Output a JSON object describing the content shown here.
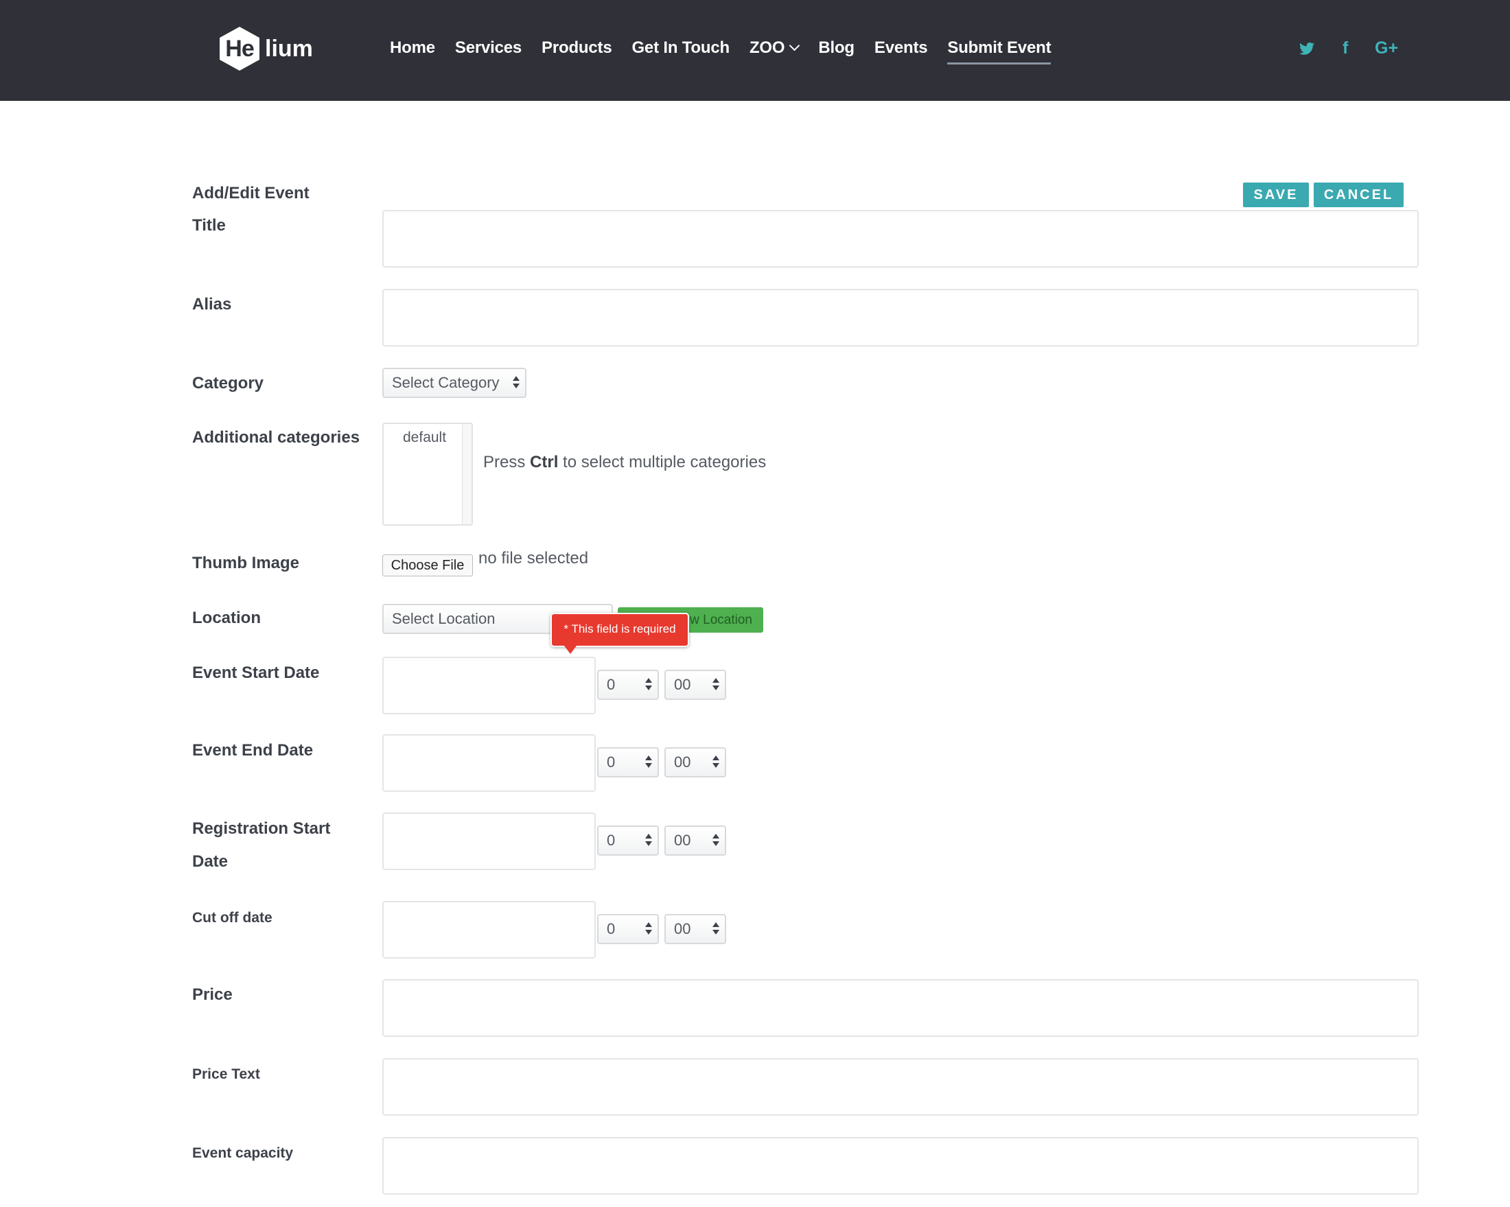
{
  "header": {
    "logo_main": "He",
    "logo_rest": "lium",
    "nav": [
      {
        "label": "Home"
      },
      {
        "label": "Services"
      },
      {
        "label": "Products"
      },
      {
        "label": "Get In Touch"
      },
      {
        "label": "ZOO"
      },
      {
        "label": "Blog"
      },
      {
        "label": "Events"
      },
      {
        "label": "Submit Event"
      }
    ],
    "social": {
      "twitter": "twitter-icon",
      "facebook": "f",
      "google": "G+"
    }
  },
  "form": {
    "heading": "Add/Edit Event",
    "save_label": "SAVE",
    "cancel_label": "CANCEL",
    "title_label": "Title",
    "alias_label": "Alias",
    "category_label": "Category",
    "category_value": "Select Category",
    "additional_label": "Additional categories",
    "additional_option": "default",
    "hint_pre": "Press",
    "hint_key": "Ctrl",
    "hint_post": "to select multiple categories",
    "thumb_label": "Thumb Image",
    "choose_file": "Choose File",
    "no_file": "no file selected",
    "location_label": "Location",
    "location_value": "Select Location",
    "new_location": "w Location",
    "required_msg": "* This field is required",
    "start_label": "Event Start Date",
    "end_label": "Event End Date",
    "reg_label": "Registration Start Date",
    "cutoff_label": "Cut off date",
    "price_label": "Price",
    "price_text_label": "Price Text",
    "capacity_label": "Event capacity",
    "hour_value": "0",
    "minute_value": "00"
  },
  "colors": {
    "header_bg": "#2f3038",
    "accent": "#3ba9b0",
    "error": "#e8392f",
    "success": "#4fb050"
  }
}
